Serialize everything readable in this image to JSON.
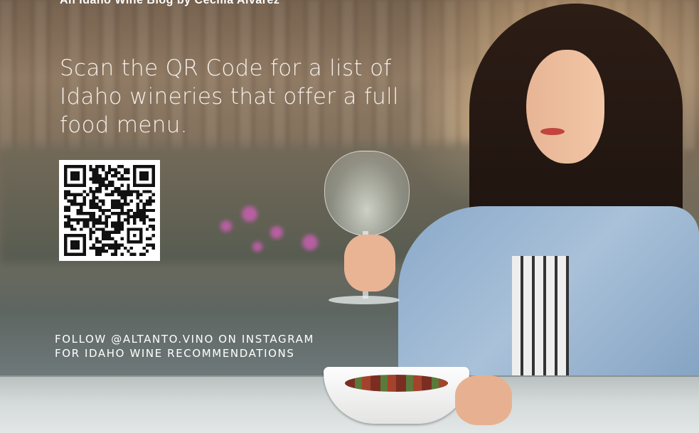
{
  "ad": {
    "tagline": "An Idaho Wine Blog by Cecilia Alvarez",
    "headline": "Scan the QR Code for a list of Idaho wineries that offer a full food menu.",
    "qr_code": {
      "icon": "qr-code-icon"
    },
    "follow_line_1": "FOLLOW @ALTANTO.VINO ON INSTAGRAM",
    "follow_line_2": "FOR IDAHO WINE RECOMMENDATIONS"
  },
  "colors": {
    "text": "#ffffff",
    "headline_text": "#f4efe8",
    "jacket": "#8aa9c9",
    "hair": "#2c1d15"
  }
}
